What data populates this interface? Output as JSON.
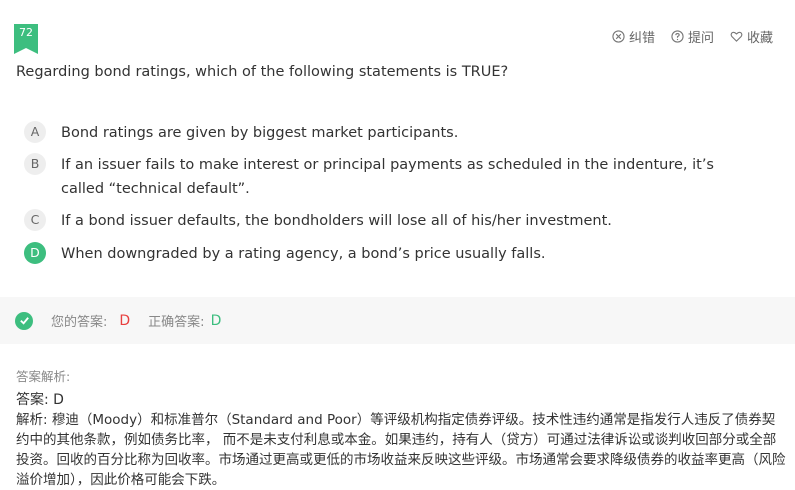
{
  "question": {
    "number": "72",
    "text": "Regarding bond ratings, which of the following statements is TRUE?"
  },
  "toolbar": {
    "report_label": "纠错",
    "ask_label": "提问",
    "favorite_label": "收藏"
  },
  "options": [
    {
      "letter": "A",
      "text": "Bond ratings are given by biggest market participants."
    },
    {
      "letter": "B",
      "text": "If an issuer fails to make interest or principal payments as scheduled in the indenture, it’s called “technical default”."
    },
    {
      "letter": "C",
      "text": "If a bond issuer defaults, the bondholders will lose all of his/her investment."
    },
    {
      "letter": "D",
      "text": "When downgraded by a rating agency, a bond’s price usually falls."
    }
  ],
  "answer_bar": {
    "your_answer_label": "您的答案:",
    "your_answer": "D",
    "correct_answer_label": "正确答案:",
    "correct_answer": "D"
  },
  "analysis": {
    "title": "答案解析:",
    "answer": "答案: D",
    "body": "解析: 穆迪（Moody）和标准普尔（Standard and Poor）等评级机构指定债券评级。技术性违约通常是指发行人违反了债券契约中的其他条款，例如债务比率， 而不是未支付利息或本金。如果违约，持有人（贷方）可通过法律诉讼或谈判收回部分或全部投资。回收的百分比称为回收率。市场通过更高或更低的市场收益来反映这些评级。市场通常会要求降级债券的收益率更高（风险溢价增加），因此价格可能会下跌。"
  },
  "colors": {
    "accent": "#3dbe7f",
    "wrong": "#e8403f"
  }
}
